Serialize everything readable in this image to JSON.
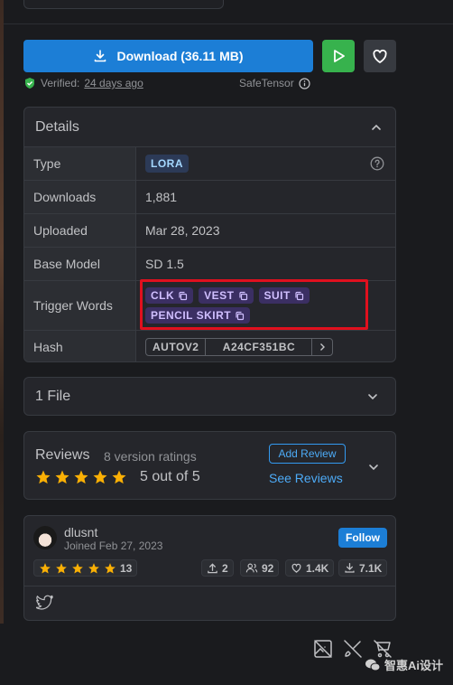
{
  "download": {
    "label": "Download (36.11 MB)"
  },
  "verified": {
    "prefix": "Verified:",
    "date": "24 days ago"
  },
  "safetensor": {
    "label": "SafeTensor"
  },
  "details": {
    "title": "Details",
    "type_label": "Type",
    "type_value": "LORA",
    "downloads_label": "Downloads",
    "downloads_value": "1,881",
    "uploaded_label": "Uploaded",
    "uploaded_value": "Mar 28, 2023",
    "base_model_label": "Base Model",
    "base_model_value": "SD 1.5",
    "trigger_label": "Trigger Words",
    "trigger_words": [
      "CLK",
      "VEST",
      "SUIT",
      "PENCIL SKIRT"
    ],
    "hash_label": "Hash",
    "hash_type": "AUTOV2",
    "hash_value": "A24CF351BC"
  },
  "files": {
    "label": "1 File"
  },
  "reviews": {
    "title": "Reviews",
    "count": "8 version ratings",
    "score": "5 out of 5",
    "rating": 5,
    "add_label": "Add Review",
    "see_label": "See Reviews"
  },
  "creator": {
    "name": "dlusnt",
    "joined": "Joined Feb 27, 2023",
    "follow_label": "Follow",
    "stars": 5,
    "rating_count": "13",
    "uploads": "2",
    "followers": "92",
    "likes": "1.4K",
    "downloads": "7.1K"
  },
  "watermark": {
    "text": "智惠Ai设计"
  },
  "colors": {
    "accent": "#1c7ed6",
    "play": "#37b24d",
    "star": "#fab005",
    "highlight": "#e0101e"
  }
}
